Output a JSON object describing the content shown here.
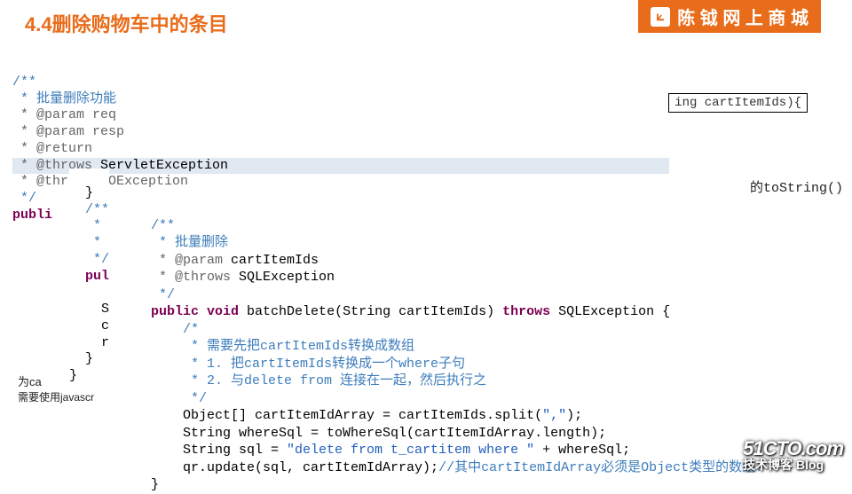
{
  "banner": {
    "icon": "⟀",
    "text": "陈 钺 网 上 商 城"
  },
  "title_partial": "4.4删除购物车中的条目",
  "snippet_top": "ing cartItemIds){",
  "snippet_mid": "的toString()",
  "layer1": {
    "l1": "/**",
    "l2": " * 批量删除功能",
    "l3": " * @param req",
    "l4": " * @param resp",
    "l5": " * @return",
    "l6a": " * @throws ",
    "l6b": "ServletException",
    "l7": " * @throws IOException",
    "l8": " */",
    "l9": "publi"
  },
  "layer2": {
    "l1": "  }",
    "l2a": "  /**",
    "l3a": "   *",
    "l4a": "   *",
    "l5a": "   */",
    "l6a": "  pul",
    "l7": "",
    "l8": "    S",
    "l9": "    c",
    "l10": "    r",
    "l11": "  }",
    "l12": "}"
  },
  "layer3": {
    "c1": "/**",
    "c2": " * 批量删除",
    "c3a": " * @param ",
    "c3b": "cartItemIds",
    "c4a": " * @throws ",
    "c4b": "SQLException",
    "c5": " */",
    "sig_pub": "public",
    "sig_void": "void",
    "sig_name": " batchDelete",
    "sig_args": "(String cartItemIds) ",
    "sig_throws": "throws",
    "sig_ex": " SQLException {",
    "ic1": "    /*",
    "ic2": "     * 需要先把cartItemIds转换成数组",
    "ic3": "     * 1. 把cartItemIds转换成一个where子句",
    "ic4": "     * 2. 与delete from 连接在一起，然后执行之",
    "ic5": "     */",
    "s1a": "    Object[] cartItemIdArray = cartItemIds.split(",
    "s1b": "\",\"",
    "s1c": ");",
    "s2": "    String whereSql = toWhereSql(cartItemIdArray.length);",
    "s3a": "    String sql = ",
    "s3b": "\"delete from t_cartitem where \"",
    "s3c": " + whereSql;",
    "s4a": "    qr.update(sql, cartItemIdArray);",
    "s4b": "//其中cartItemIdArray必须是Object类型的数组!",
    "s5": "}"
  },
  "bottom_left": {
    "l1": "  为ca",
    "l2": "需要使用javascr"
  },
  "watermark": {
    "domain": "51CTO.com",
    "sub": "技术博客   Blog"
  }
}
